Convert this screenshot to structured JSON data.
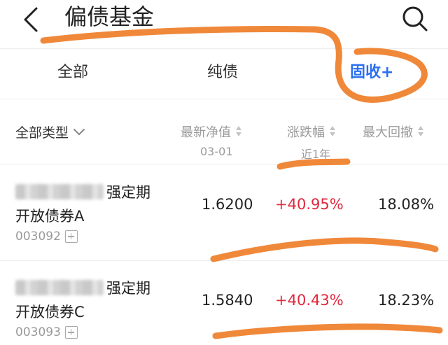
{
  "header": {
    "title": "偏债基金",
    "back_icon": "chevron-left-icon",
    "search_icon": "search-icon"
  },
  "tabs": [
    {
      "label": "全部",
      "active": false
    },
    {
      "label": "纯债",
      "active": false
    },
    {
      "label": "固收+",
      "active": true
    }
  ],
  "columns": {
    "filter_label": "全部类型",
    "nav_label": "最新净值",
    "nav_date": "03-01",
    "change_label": "涨跌幅",
    "change_period": "近1年",
    "drawdown_label": "最大回撤"
  },
  "funds": [
    {
      "name_line1": "强定期",
      "name_line2": "开放债券A",
      "code": "003092",
      "nav": "1.6200",
      "change": "+40.95%",
      "drawdown": "18.08%"
    },
    {
      "name_line1": "强定期",
      "name_line2": "开放债券C",
      "code": "003093",
      "nav": "1.5840",
      "change": "+40.43%",
      "drawdown": "18.23%"
    }
  ],
  "colors": {
    "accent": "#2a6ff2",
    "positive": "#e0283c",
    "annotation": "#f0883a"
  }
}
